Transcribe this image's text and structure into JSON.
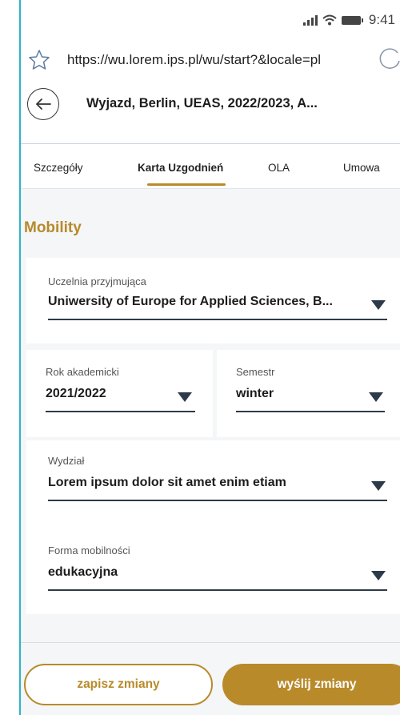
{
  "status_bar": {
    "time": "9:41"
  },
  "browser": {
    "url": "https://wu.lorem.ips.pl/wu/start?&locale=pl"
  },
  "header": {
    "title": "Wyjazd, Berlin, UEAS, 2022/2023, A..."
  },
  "tabs": [
    {
      "label": "Szczegóły",
      "active": false
    },
    {
      "label": "Karta Uzgodnień",
      "active": true
    },
    {
      "label": "OLA",
      "active": false
    },
    {
      "label": "Umowa",
      "active": false
    }
  ],
  "section": {
    "title": "Mobility"
  },
  "form": {
    "host_university": {
      "label": "Uczelnia przyjmująca",
      "value": "Uniwersity of Europe for Applied Sciences, B..."
    },
    "academic_year": {
      "label": "Rok akademicki",
      "value": "2021/2022"
    },
    "semester": {
      "label": "Semestr",
      "value": "winter"
    },
    "faculty": {
      "label": "Wydział",
      "value": "Lorem ipsum dolor sit amet enim etiam"
    },
    "mobility_form": {
      "label": "Forma mobilności",
      "value": "edukacyjna"
    }
  },
  "actions": {
    "save_label": "zapisz zmiany",
    "send_label": "wyślij zmiany"
  },
  "colors": {
    "accent": "#b88a2a",
    "frame_border": "#2bb4c8",
    "background": "#f4f6f8"
  }
}
